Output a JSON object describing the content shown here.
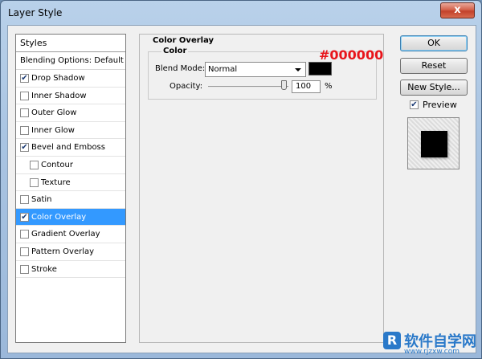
{
  "window": {
    "title": "Layer Style",
    "close_glyph": "x"
  },
  "styles_panel": {
    "header": "Styles",
    "blending_default": "Blending Options: Default",
    "items": [
      {
        "label": "Drop Shadow",
        "checked": true,
        "indent": false,
        "selected": false
      },
      {
        "label": "Inner Shadow",
        "checked": false,
        "indent": false,
        "selected": false
      },
      {
        "label": "Outer Glow",
        "checked": false,
        "indent": false,
        "selected": false
      },
      {
        "label": "Inner Glow",
        "checked": false,
        "indent": false,
        "selected": false
      },
      {
        "label": "Bevel and Emboss",
        "checked": true,
        "indent": false,
        "selected": false
      },
      {
        "label": "Contour",
        "checked": false,
        "indent": true,
        "selected": false
      },
      {
        "label": "Texture",
        "checked": false,
        "indent": true,
        "selected": false
      },
      {
        "label": "Satin",
        "checked": false,
        "indent": false,
        "selected": false
      },
      {
        "label": "Color Overlay",
        "checked": true,
        "indent": false,
        "selected": true
      },
      {
        "label": "Gradient Overlay",
        "checked": false,
        "indent": false,
        "selected": false
      },
      {
        "label": "Pattern Overlay",
        "checked": false,
        "indent": false,
        "selected": false
      },
      {
        "label": "Stroke",
        "checked": false,
        "indent": false,
        "selected": false
      }
    ]
  },
  "color_overlay": {
    "group_title": "Color Overlay",
    "sub_title": "Color",
    "blend_mode_label": "Blend Mode:",
    "blend_mode_value": "Normal",
    "swatch_color": "#000000",
    "hex_annotation": "#000000",
    "opacity_label": "Opacity:",
    "opacity_value": "100",
    "opacity_level": 1.0,
    "percent": "%"
  },
  "buttons": {
    "ok": "OK",
    "reset": "Reset",
    "new_style": "New Style...",
    "preview": "Preview",
    "preview_checked": true
  },
  "watermark": {
    "logo": "R",
    "name": "软件自学网",
    "url": "www.rjzxw.com"
  }
}
